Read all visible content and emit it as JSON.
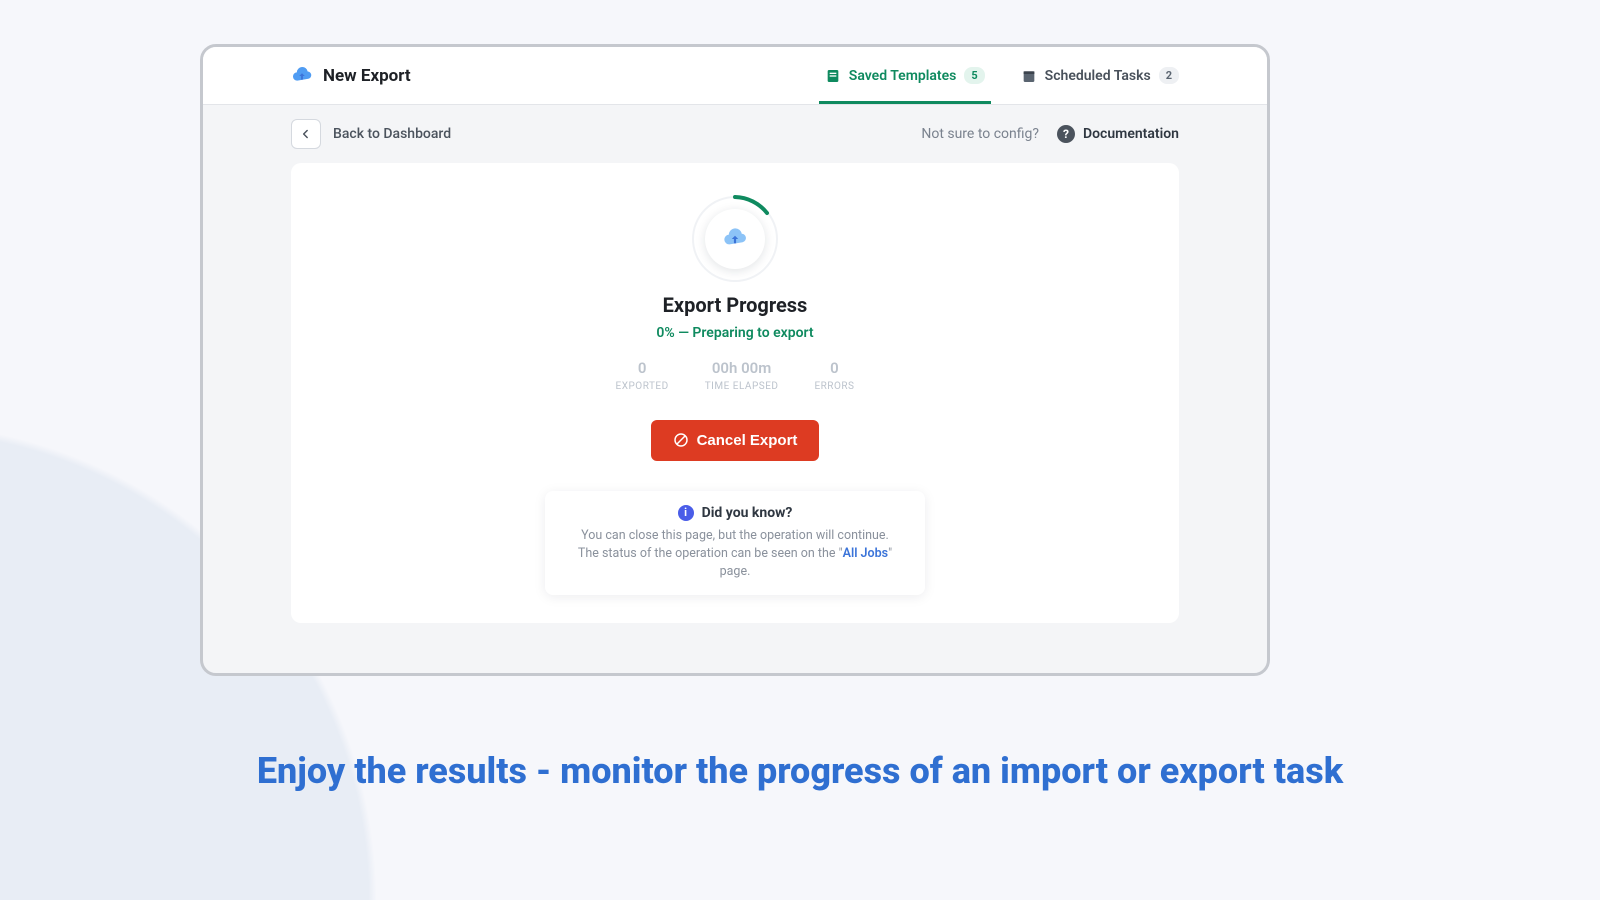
{
  "header": {
    "title": "New Export",
    "tabs": [
      {
        "label": "Saved Templates",
        "count": "5",
        "active": true
      },
      {
        "label": "Scheduled Tasks",
        "count": "2",
        "active": false
      }
    ]
  },
  "subbar": {
    "back_label": "Back to Dashboard",
    "help_prompt": "Not sure to config?",
    "doc_label": "Documentation"
  },
  "progress": {
    "title": "Export Progress",
    "status_line": "0% — Preparing to export",
    "stats": {
      "exported": {
        "value": "0",
        "label": "EXPORTED"
      },
      "elapsed": {
        "value": "00h 00m",
        "label": "TIME ELAPSED"
      },
      "errors": {
        "value": "0",
        "label": "ERRORS"
      }
    },
    "cancel_label": "Cancel Export"
  },
  "tip": {
    "title": "Did you know?",
    "line1": "You can close this page, but the operation will continue.",
    "line2_pre": "The status of the operation can be seen on the \"",
    "line2_link": "All Jobs",
    "line2_post": "\" page."
  },
  "tagline": "Enjoy the results - monitor the progress of an import or export task",
  "colors": {
    "accent_green": "#0f8a5f",
    "danger_red": "#dd3b22",
    "brand_blue": "#2f6fd1"
  }
}
